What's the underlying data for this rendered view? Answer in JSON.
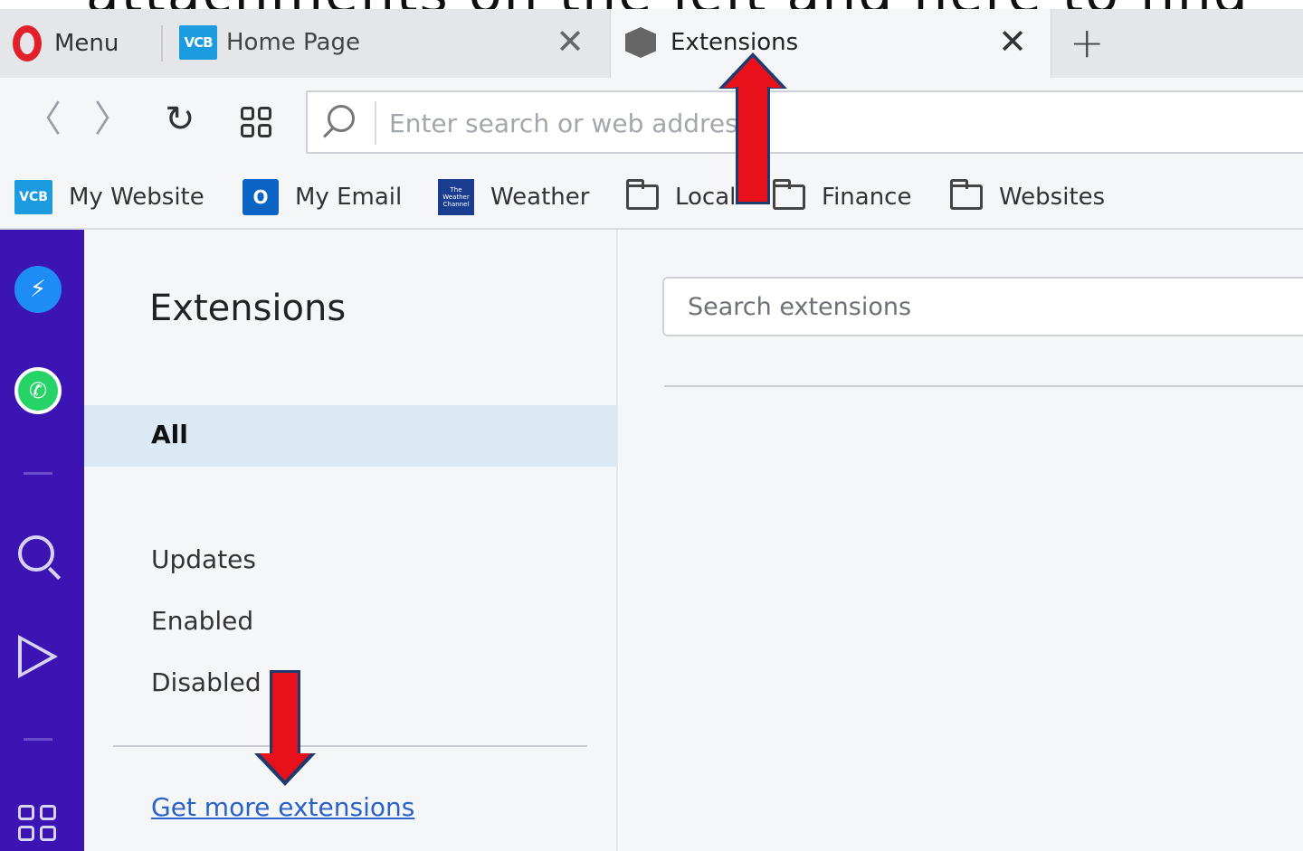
{
  "cutoff_text": "attachments on the left and here to find",
  "tabs": {
    "menu_label": "Menu",
    "home": {
      "icon_text": "VCB",
      "title": "Home Page"
    },
    "extensions": {
      "title": "Extensions"
    },
    "new_tab_glyph": "+",
    "close_glyph": "✕"
  },
  "nav": {
    "back_glyph": "〈",
    "forward_glyph": "〉",
    "reload_glyph": "↻",
    "address_placeholder": "Enter search or web address"
  },
  "bookmarks": [
    {
      "icon": "vcb-icon",
      "icon_text": "VCB",
      "label": "My Website"
    },
    {
      "icon": "outlook-icon",
      "icon_text": "O",
      "label": "My Email"
    },
    {
      "icon": "weather-channel-icon",
      "icon_text": "The Weather Channel",
      "label": "Weather"
    },
    {
      "icon": "folder-icon",
      "label": "Local"
    },
    {
      "icon": "folder-icon",
      "label": "Finance"
    },
    {
      "icon": "folder-icon",
      "label": "Websites"
    }
  ],
  "sidebar": {
    "items": [
      "messenger-icon",
      "whatsapp-icon",
      "search-icon",
      "send-icon",
      "apps-grid-icon"
    ]
  },
  "extensions_page": {
    "title": "Extensions",
    "filters": {
      "all": "All",
      "updates": "Updates",
      "enabled": "Enabled",
      "disabled": "Disabled"
    },
    "get_more_link": "Get more extensions",
    "search_placeholder": "Search extensions"
  },
  "colors": {
    "sidebar_bg": "#3b14b3",
    "selected_filter_bg": "#dbe9f4",
    "link": "#2a62c9",
    "annotation_arrow": "#e8101a",
    "opera_red": "#e2202a",
    "vcb_blue": "#1c9be0"
  }
}
